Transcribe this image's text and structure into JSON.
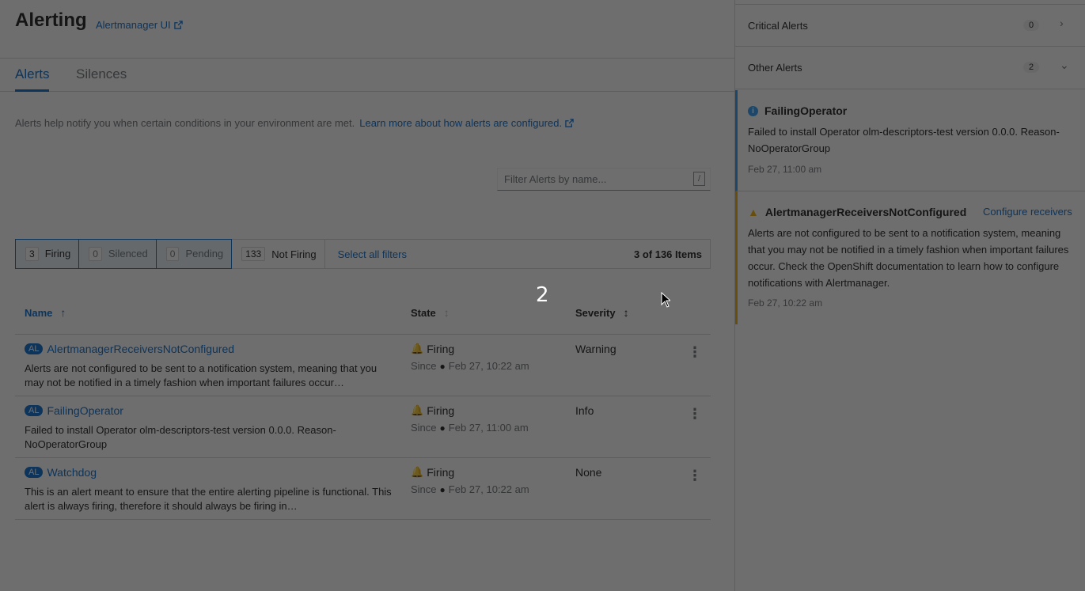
{
  "header": {
    "title": "Alerting",
    "alertmanager_link": "Alertmanager UI"
  },
  "tabs": [
    {
      "label": "Alerts",
      "active": true
    },
    {
      "label": "Silences",
      "active": false
    }
  ],
  "help": {
    "text": "Alerts help notify you when certain conditions in your environment are met.",
    "link": "Learn more about how alerts are configured."
  },
  "filter": {
    "placeholder": "Filter Alerts by name...",
    "shortcut": "/"
  },
  "chips": {
    "firing": {
      "count": "3",
      "label": "Firing"
    },
    "silenced": {
      "count": "0",
      "label": "Silenced"
    },
    "pending": {
      "count": "0",
      "label": "Pending"
    },
    "not_firing": {
      "count": "133",
      "label": "Not Firing"
    },
    "select_all": "Select all filters",
    "items_count": "3 of 136 Items"
  },
  "table": {
    "columns": {
      "name": "Name",
      "state": "State",
      "severity": "Severity"
    },
    "rows": [
      {
        "badge": "AL",
        "name": "AlertmanagerReceiversNotConfigured",
        "description": "Alerts are not configured to be sent to a notification system, meaning that you may not be notified in a timely fashion when important failures occur…",
        "state": "Firing",
        "since_label": "Since",
        "since": "Feb 27, 10:22 am",
        "severity": "Warning"
      },
      {
        "badge": "AL",
        "name": "FailingOperator",
        "description": "Failed to install Operator olm-descriptors-test version 0.0.0. Reason-NoOperatorGroup",
        "state": "Firing",
        "since_label": "Since",
        "since": "Feb 27, 11:00 am",
        "severity": "Info"
      },
      {
        "badge": "AL",
        "name": "Watchdog",
        "description": "This is an alert meant to ensure that the entire alerting pipeline is functional. This alert is always firing, therefore it should always be firing in…",
        "state": "Firing",
        "since_label": "Since",
        "since": "Feb 27, 10:22 am",
        "severity": "None"
      }
    ]
  },
  "overlay_number": "2",
  "drawer": {
    "groups": [
      {
        "label": "Critical Alerts",
        "count": "0",
        "toggle": "›"
      },
      {
        "label": "Other Alerts",
        "count": "2",
        "toggle": "⌄"
      }
    ],
    "notifications": [
      {
        "title": "FailingOperator",
        "body": "Failed to install Operator olm-descriptors-test version 0.0.0. Reason-NoOperatorGroup",
        "time": "Feb 27, 11:00 am"
      },
      {
        "title": "AlertmanagerReceiversNotConfigured",
        "action": "Configure receivers",
        "body": "Alerts are not configured to be sent to a notification system, meaning that you may not be notified in a timely fashion when important failures occur. Check the OpenShift documentation to learn how to configure notifications with Alertmanager.",
        "time": "Feb 27, 10:22 am"
      }
    ]
  },
  "colors": {
    "link": "#0066cc",
    "firing": "#c9190b",
    "info": "#2b9af3",
    "warning": "#f0ab00"
  }
}
